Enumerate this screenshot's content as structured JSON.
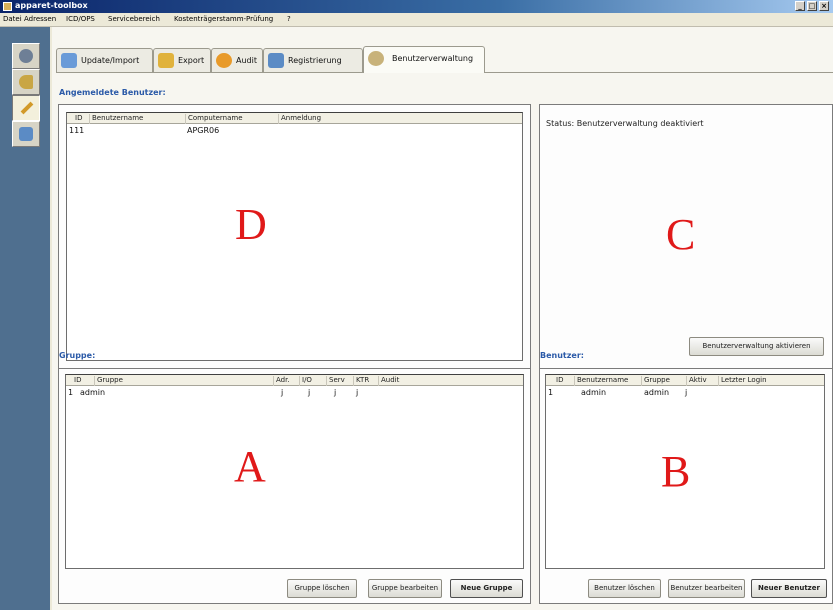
{
  "window": {
    "title": "apparet-toolbox",
    "buttons": [
      "_",
      "□",
      "×"
    ]
  },
  "menu": [
    "Datei",
    "Adressen",
    "ICD/OPS",
    "Servicebereich",
    "Kostenträgerstamm-Prüfung",
    "?"
  ],
  "sidebar_icons": [
    "search-icon",
    "key-icon",
    "wrench-icon",
    "users-icon"
  ],
  "tabs": [
    {
      "label": "Update/Import",
      "icon": "update-icon"
    },
    {
      "label": "Export",
      "icon": "export-icon"
    },
    {
      "label": "Audit",
      "icon": "audit-icon"
    },
    {
      "label": "Registrierung",
      "icon": "registration-icon"
    },
    {
      "label": "Benutzerverwaltung",
      "icon": "users-icon",
      "active": true
    }
  ],
  "logged_in": {
    "label": "Angemeldete Benutzer:",
    "columns": [
      "ID",
      "Benutzername",
      "Computername",
      "Anmeldung"
    ],
    "rows": [
      [
        "111",
        "",
        "APGR06",
        ""
      ]
    ],
    "marker": "D"
  },
  "status_panel": {
    "status_text": "Status: Benutzerverwaltung deaktiviert",
    "activate_button": "Benutzerverwaltung aktivieren",
    "marker": "C"
  },
  "groups": {
    "label": "Gruppe:",
    "columns": [
      "ID",
      "Gruppe",
      "Adr.",
      "I/O",
      "Serv",
      "KTR",
      "Audit"
    ],
    "rows": [
      [
        "1",
        "admin",
        "j",
        "j",
        "j",
        "j",
        ""
      ]
    ],
    "buttons": {
      "delete": "Gruppe löschen",
      "edit": "Gruppe bearbeiten",
      "new": "Neue Gruppe"
    },
    "marker": "A"
  },
  "users": {
    "label": "Benutzer:",
    "columns": [
      "ID",
      "Benutzername",
      "Gruppe",
      "Aktiv",
      "Letzter Login"
    ],
    "rows": [
      [
        "1",
        "admin",
        "admin",
        "j",
        ""
      ]
    ],
    "buttons": {
      "delete": "Benutzer löschen",
      "edit": "Benutzer bearbeiten",
      "new": "Neuer Benutzer"
    },
    "marker": "B"
  },
  "colors": {
    "accent": "#2b5aa8",
    "marker": "#e01919",
    "sidebar": "#4f6f8f"
  }
}
